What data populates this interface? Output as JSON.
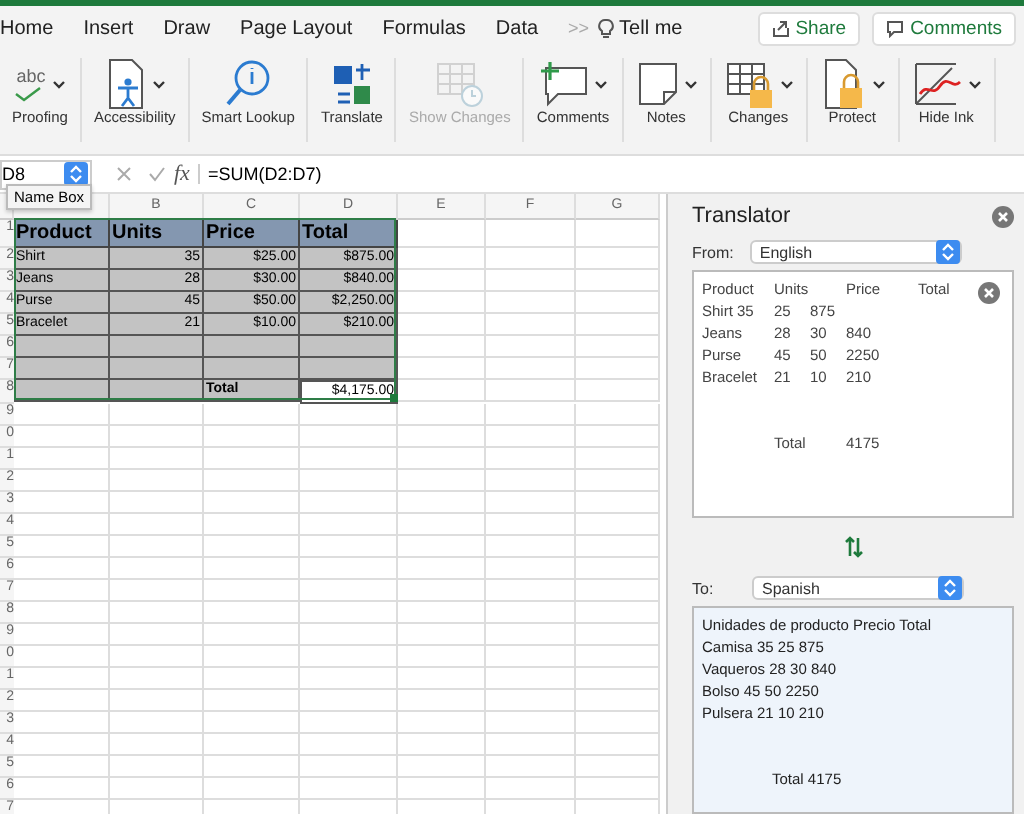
{
  "menu_tabs": [
    {
      "label": "Home",
      "selected": false
    },
    {
      "label": "Insert",
      "selected": false
    },
    {
      "label": "Draw",
      "selected": false
    },
    {
      "label": "Page Layout",
      "selected": false
    },
    {
      "label": "Formulas",
      "selected": false
    },
    {
      "label": "Data",
      "selected": false
    }
  ],
  "overflow": ">>",
  "tell_me": "Tell me",
  "share_button": "Share",
  "comments_button": "Comments",
  "toolbar": [
    {
      "kind": "proofing",
      "icon_text": "abc",
      "label": "Proofing",
      "dropdown": true,
      "disabled": false
    },
    {
      "kind": "accessibility",
      "label": "Accessibility",
      "dropdown": true,
      "disabled": false
    },
    {
      "kind": "lookup",
      "label": "Smart Lookup",
      "dropdown": false,
      "disabled": false
    },
    {
      "kind": "translate",
      "label": "Translate",
      "dropdown": false,
      "disabled": false
    },
    {
      "kind": "showchanges",
      "label": "Show Changes",
      "dropdown": false,
      "disabled": true
    },
    {
      "kind": "comment",
      "label": "Comments",
      "dropdown": true,
      "disabled": false
    },
    {
      "kind": "note",
      "label": "Notes",
      "dropdown": true,
      "disabled": false
    },
    {
      "kind": "changes",
      "label": "Changes",
      "dropdown": true,
      "disabled": false
    },
    {
      "kind": "protect",
      "label": "Protect",
      "dropdown": true,
      "disabled": false
    },
    {
      "kind": "ink",
      "label": "Hide Ink",
      "dropdown": true,
      "disabled": false
    }
  ],
  "name_box": {
    "value": "D8",
    "tooltip": "Name Box"
  },
  "formula_bar": {
    "fx": "fx",
    "value": "=SUM(D2:D7)"
  },
  "sheet": {
    "columns": [
      "B",
      "C",
      "D",
      "E",
      "F",
      "G"
    ],
    "row_numbers": [
      "1",
      "2",
      "3",
      "4",
      "5",
      "6",
      "7",
      "8",
      "9",
      "0",
      "1",
      "2",
      "3",
      "4",
      "5",
      "6",
      "7",
      "8",
      "9",
      "0",
      "1",
      "2",
      "3",
      "4",
      "5",
      "6",
      "7"
    ],
    "rows": [
      {
        "kind": "header",
        "cells": [
          "Product",
          "Units",
          "Price",
          "Total"
        ]
      },
      {
        "kind": "data",
        "cells": [
          "Shirt",
          "35",
          "$25.00",
          "$875.00"
        ]
      },
      {
        "kind": "data",
        "cells": [
          "Jeans",
          "28",
          "$30.00",
          "$840.00"
        ]
      },
      {
        "kind": "data",
        "cells": [
          "Purse",
          "45",
          "$50.00",
          "$2,250.00"
        ]
      },
      {
        "kind": "data",
        "cells": [
          "Bracelet",
          "21",
          "$10.00",
          "$210.00"
        ]
      },
      {
        "kind": "blank"
      },
      {
        "kind": "blank"
      },
      {
        "kind": "total",
        "cells": [
          "Total",
          "$4,175.00"
        ]
      }
    ]
  },
  "translator": {
    "title": "Translator",
    "from_label": "From:",
    "from_language": "English",
    "source_lines": [
      {
        "kind": "header",
        "cells": [
          "Product",
          "Units",
          "Price",
          "Total"
        ]
      },
      {
        "kind": "data",
        "cells": [
          "Shirt 35",
          "25",
          "875"
        ]
      },
      {
        "kind": "data",
        "cells": [
          "Jeans",
          "28",
          "30",
          "840"
        ]
      },
      {
        "kind": "data",
        "cells": [
          "Purse",
          "45",
          "50",
          "2250"
        ]
      },
      {
        "kind": "data",
        "cells": [
          "Bracelet",
          "21",
          "10",
          "210"
        ]
      },
      {
        "kind": "total",
        "cells": [
          "Total",
          "4175"
        ]
      }
    ],
    "to_label": "To:",
    "to_language": "Spanish",
    "target_lines": [
      {
        "kind": "line",
        "text": "Unidades de producto Precio Total"
      },
      {
        "kind": "line",
        "text": "Camisa 35 25 875"
      },
      {
        "kind": "line",
        "text": "Vaqueros 28 30 840"
      },
      {
        "kind": "line",
        "text": "Bolso 45 50 2250"
      },
      {
        "kind": "line",
        "text": "Pulsera 21 10 210"
      },
      {
        "kind": "total",
        "text": "Total 4175"
      }
    ]
  }
}
